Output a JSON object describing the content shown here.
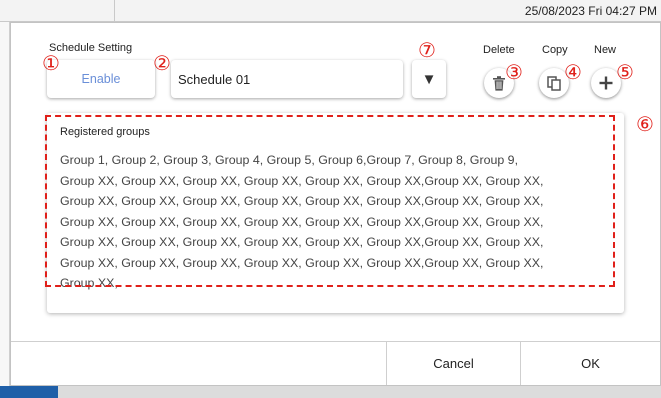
{
  "status_bar": {
    "datetime": "25/08/2023 Fri 04:27 PM"
  },
  "schedule": {
    "section_label": "Schedule Setting",
    "enable_label": "Enable",
    "name_value": "Schedule 01",
    "dropdown_glyph": "▼"
  },
  "actions": {
    "delete_label": "Delete",
    "copy_label": "Copy",
    "new_label": "New",
    "delete_icon": "trash-icon",
    "copy_icon": "copy-icon",
    "new_icon": "plus-icon"
  },
  "callouts": [
    "①",
    "②",
    "③",
    "④",
    "⑤",
    "⑥",
    "⑦"
  ],
  "groups": {
    "title": "Registered groups",
    "lines": [
      "Group 1, Group 2, Group 3, Group 4, Group 5, Group 6,Group 7, Group 8, Group 9,",
      "Group XX, Group XX, Group XX, Group XX, Group XX, Group XX,Group XX, Group XX,",
      "Group XX, Group XX, Group XX, Group XX, Group XX, Group XX,Group XX, Group XX,",
      "Group XX, Group XX, Group XX, Group XX, Group XX, Group XX,Group XX, Group XX,",
      "Group XX, Group XX, Group XX, Group XX, Group XX, Group XX,Group XX, Group XX,",
      "Group XX, Group XX, Group XX, Group XX, Group XX, Group XX,Group XX, Group XX,",
      "Group XX,"
    ]
  },
  "footer": {
    "cancel_label": "Cancel",
    "ok_label": "OK"
  },
  "colors": {
    "annotation": "#e0201a",
    "enable_text": "#6a8fd8",
    "taskbar_accent": "#1f5fa8"
  }
}
